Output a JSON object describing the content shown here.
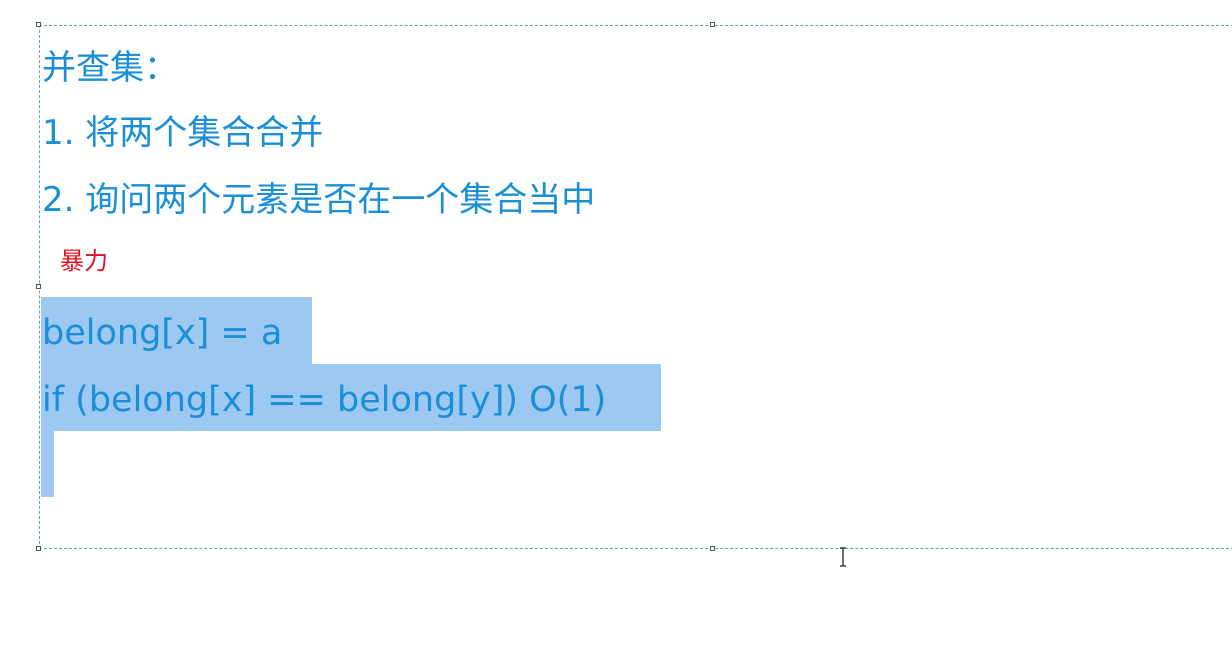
{
  "content": {
    "title": "并查集：",
    "item1": "1. 将两个集合合并",
    "item2": "2. 询问两个元素是否在一个集合当中",
    "annotation": "暴力",
    "code_line1": "belong[x] = a",
    "code_line2": "if (belong[x] == belong[y]) O(1)"
  },
  "colors": {
    "text": "#1a8fd6",
    "annotation": "#e0141e",
    "selection": "#9cc8f1",
    "frame": "#5aa0d0"
  },
  "icons": {
    "cursor": "text-ibeam-cursor-icon"
  }
}
